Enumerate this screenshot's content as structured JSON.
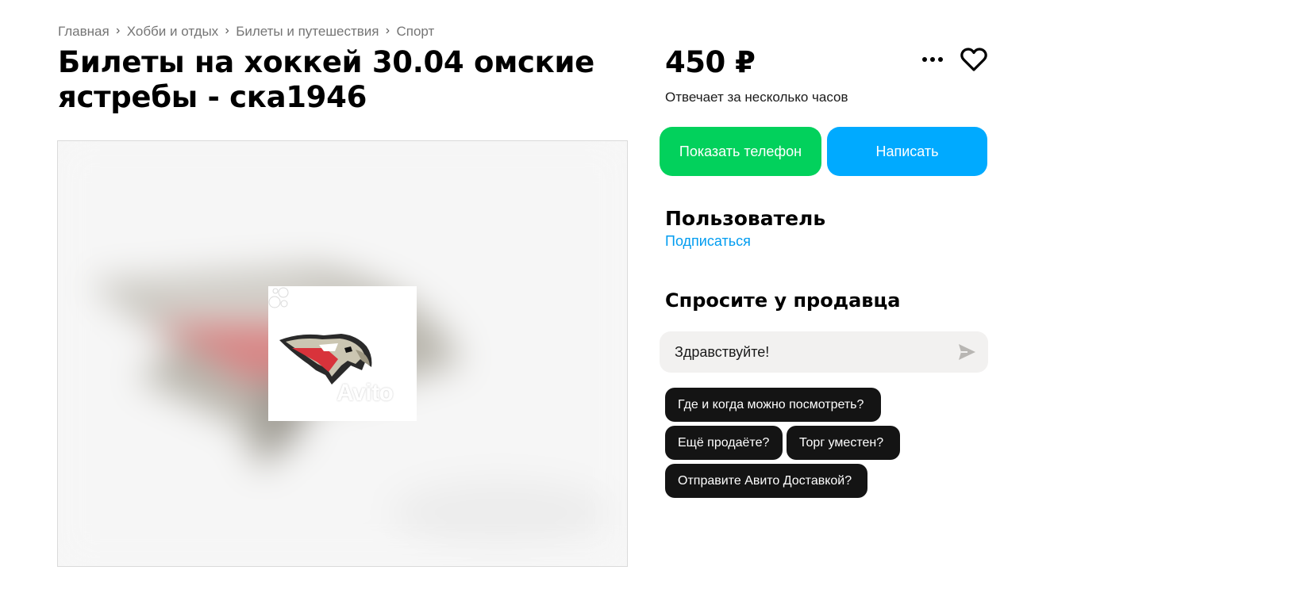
{
  "breadcrumb": {
    "items": [
      "Главная",
      "Хобби и отдых",
      "Билеты и путешествия",
      "Спорт"
    ],
    "separator": "›"
  },
  "listing": {
    "title": "Билеты на хоккей 30.04 омские ястребы - ска1946",
    "price": "450 ₽",
    "reply_time": "Отвечает за несколько часов",
    "photo_watermark": "Avito"
  },
  "actions": {
    "show_phone": "Показать телефон",
    "write": "Написать",
    "more_icon": "ellipsis-icon",
    "favorite_icon": "heart-icon"
  },
  "seller": {
    "name": "Пользователь",
    "subscribe": "Подписаться"
  },
  "ask_seller": {
    "title": "Спросите у продавца",
    "message_value": "Здравствуйте!",
    "send_icon": "send-icon",
    "quick_questions": [
      "Где и когда можно посмотреть?",
      "Ещё продаёте?",
      "Торг уместен?",
      "Отправите Авито Доставкой?"
    ]
  },
  "colors": {
    "phone_button": "#02d15c",
    "write_button": "#00aaff",
    "link": "#009cf0",
    "chip_bg": "#141414",
    "input_bg": "#f2f1f0",
    "breadcrumb_text": "#757575"
  }
}
